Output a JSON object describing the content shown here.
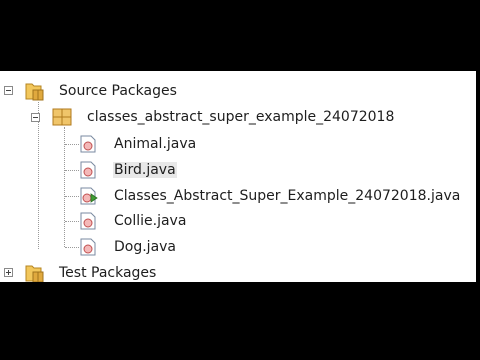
{
  "tree": {
    "source_packages": {
      "label": "Source Packages",
      "icon": "folder-package-icon",
      "expanded": true
    },
    "package": {
      "label": "classes_abstract_super_example_24072018",
      "icon": "package-icon",
      "expanded": true
    },
    "files": [
      {
        "label": "Animal.java",
        "icon": "java-class-icon",
        "selected": false
      },
      {
        "label": "Bird.java",
        "icon": "java-class-icon",
        "selected": true
      },
      {
        "label": "Classes_Abstract_Super_Example_24072018.java",
        "icon": "java-main-class-icon",
        "selected": false
      },
      {
        "label": "Collie.java",
        "icon": "java-class-icon",
        "selected": false
      },
      {
        "label": "Dog.java",
        "icon": "java-class-icon",
        "selected": false
      }
    ],
    "test_packages": {
      "label": "Test Packages",
      "icon": "folder-package-icon",
      "expanded": false
    }
  },
  "colors": {
    "background": "#000000",
    "panel": "#ffffff",
    "folder": "#e8b84a",
    "package": "#d9a441",
    "selection": "#e8e8e8",
    "run_arrow": "#3f9c35"
  }
}
